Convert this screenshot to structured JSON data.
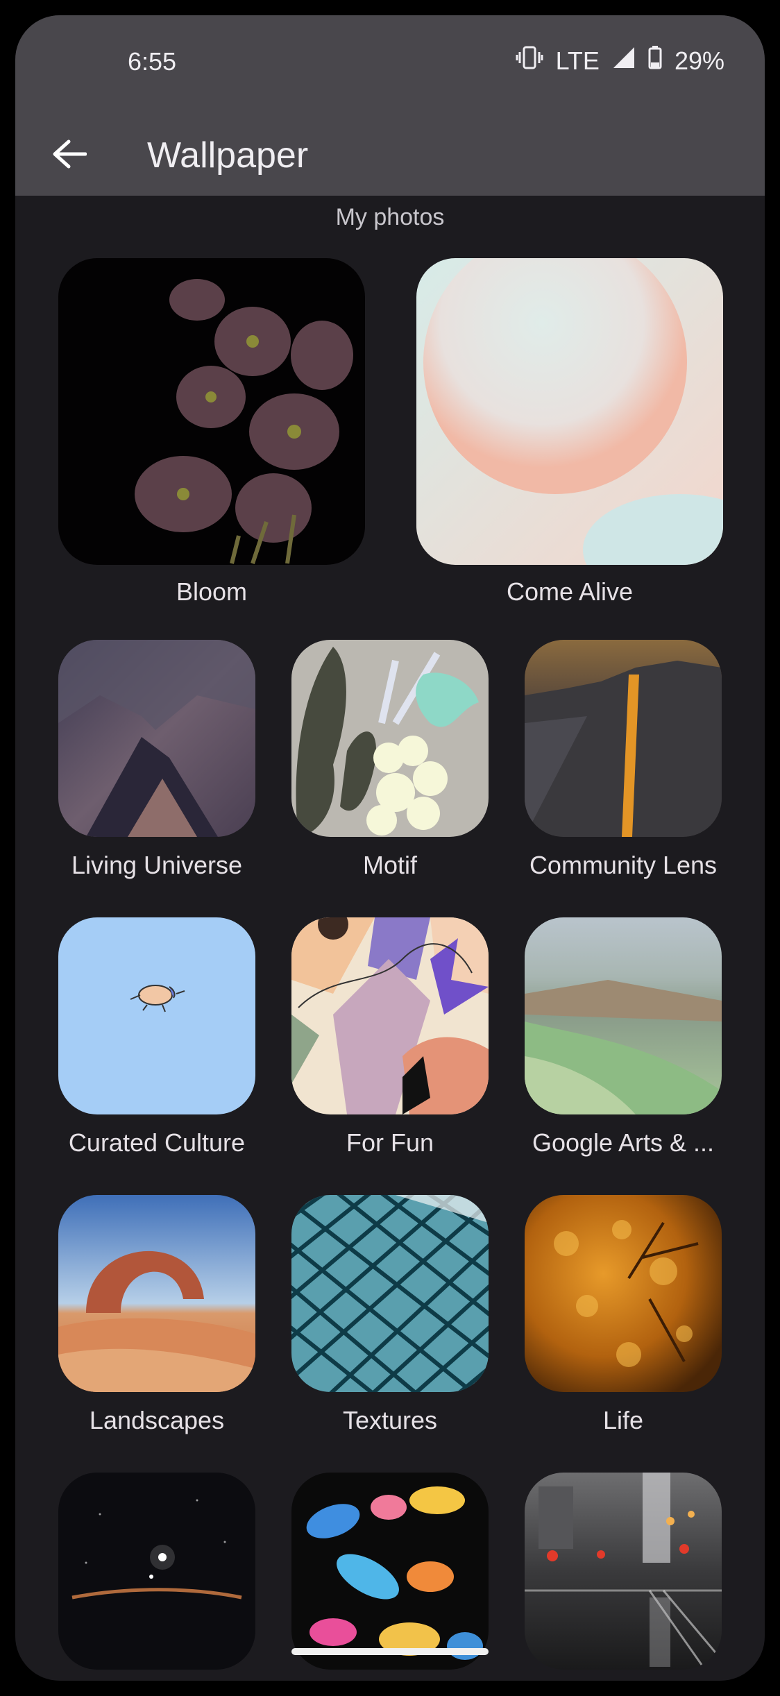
{
  "status": {
    "time": "6:55",
    "network": "LTE",
    "battery": "29%"
  },
  "appbar": {
    "title": "Wallpaper"
  },
  "section_title": "My photos",
  "categories": [
    {
      "label": "Bloom"
    },
    {
      "label": "Come Alive"
    },
    {
      "label": "Living Universe"
    },
    {
      "label": "Motif"
    },
    {
      "label": "Community Lens"
    },
    {
      "label": "Curated Culture"
    },
    {
      "label": "For Fun"
    },
    {
      "label": "Google Arts & ..."
    },
    {
      "label": "Landscapes"
    },
    {
      "label": "Textures"
    },
    {
      "label": "Life"
    }
  ],
  "icons": [
    "back-arrow-icon",
    "vibrate-icon",
    "signal-icon",
    "battery-icon"
  ],
  "colors": {
    "appbar": "#49474c",
    "background": "#1c1b1f",
    "text": "#e6e1e6"
  }
}
